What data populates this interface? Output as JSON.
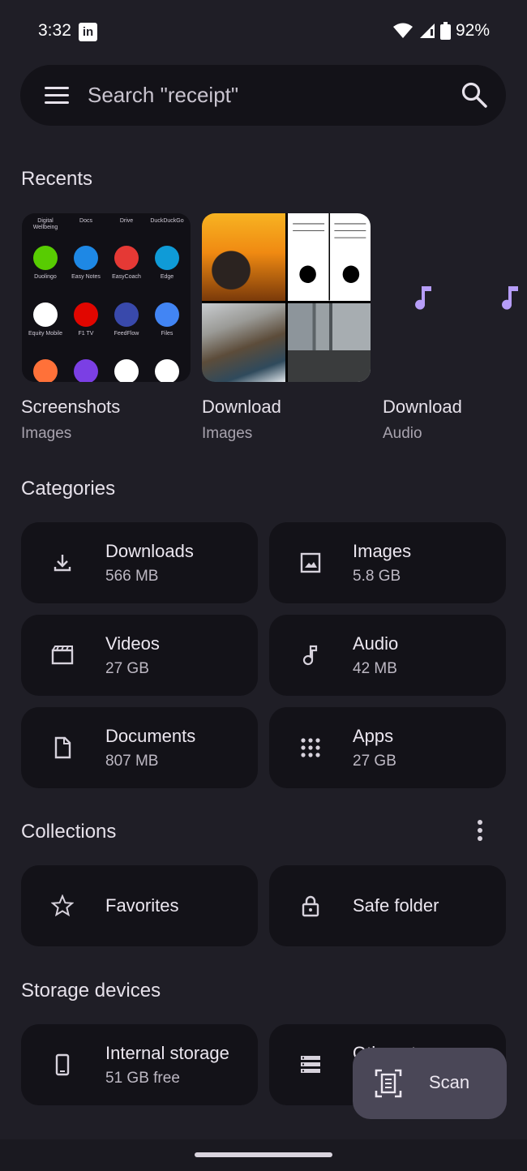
{
  "status": {
    "time": "3:32",
    "battery": "92%"
  },
  "search": {
    "placeholder": "Search \"receipt\""
  },
  "sections": {
    "recents": "Recents",
    "categories": "Categories",
    "collections": "Collections",
    "storage": "Storage devices"
  },
  "recents": [
    {
      "title": "Screenshots",
      "sub": "Images"
    },
    {
      "title": "Download",
      "sub": "Images"
    },
    {
      "title": "Download",
      "sub": "Audio"
    }
  ],
  "screenshot_thumb": {
    "top_labels": [
      "Digital Wellbeing",
      "Docs",
      "Drive",
      "DuckDuckGo"
    ],
    "apps": [
      {
        "label": "Duolingo",
        "color": "#58cc02"
      },
      {
        "label": "Easy Notes",
        "color": "#1e88e5"
      },
      {
        "label": "EasyCoach",
        "color": "#e53935"
      },
      {
        "label": "Edge",
        "color": "#0f9bd7"
      },
      {
        "label": "Equity Mobile",
        "color": "#ffffff"
      },
      {
        "label": "F1 TV",
        "color": "#e10600"
      },
      {
        "label": "FeedFlow",
        "color": "#3949ab"
      },
      {
        "label": "Files",
        "color": "#4285f4"
      },
      {
        "label": "",
        "color": "#ff7139"
      },
      {
        "label": "",
        "color": "#7b3fe4"
      },
      {
        "label": "",
        "color": "#ffffff"
      },
      {
        "label": "",
        "color": "#ffffff"
      }
    ]
  },
  "categories": [
    {
      "title": "Downloads",
      "sub": "566 MB",
      "icon": "download-icon"
    },
    {
      "title": "Images",
      "sub": "5.8 GB",
      "icon": "image-icon"
    },
    {
      "title": "Videos",
      "sub": "27 GB",
      "icon": "video-icon"
    },
    {
      "title": "Audio",
      "sub": "42 MB",
      "icon": "music-note-icon"
    },
    {
      "title": "Documents",
      "sub": "807 MB",
      "icon": "document-icon"
    },
    {
      "title": "Apps",
      "sub": "27 GB",
      "icon": "apps-grid-icon"
    }
  ],
  "collections": [
    {
      "title": "Favorites",
      "icon": "star-icon"
    },
    {
      "title": "Safe folder",
      "icon": "lock-icon"
    }
  ],
  "storage": [
    {
      "title": "Internal storage",
      "sub": "51 GB free",
      "icon": "phone-icon"
    },
    {
      "title": "Other storage",
      "icon": "storage-icon"
    }
  ],
  "fab": {
    "label": "Scan"
  },
  "colors": {
    "background": "#1f1e26",
    "card": "#131218",
    "accent": "#b69df8",
    "fab": "#4a4757"
  }
}
